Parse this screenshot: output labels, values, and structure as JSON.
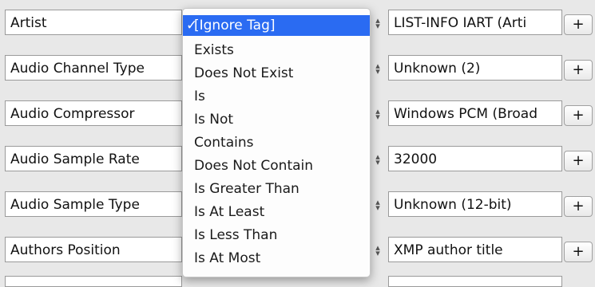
{
  "rows": [
    {
      "tag": "Artist",
      "value": "LIST-INFO IART (Arti",
      "add": "+"
    },
    {
      "tag": "Audio Channel Type",
      "value": "Unknown (2)",
      "add": "+"
    },
    {
      "tag": "Audio Compressor",
      "value": "Windows PCM (Broad",
      "add": "+"
    },
    {
      "tag": "Audio Sample Rate",
      "value": "32000",
      "add": "+"
    },
    {
      "tag": "Audio Sample Type",
      "value": "Unknown (12-bit)",
      "add": "+"
    },
    {
      "tag": "Authors Position",
      "value": "XMP author title",
      "add": "+"
    }
  ],
  "stepper": {
    "up": "▴",
    "down": "▾",
    "icon": "stepper-updown-icon"
  },
  "menu": {
    "check": "✓",
    "selected": "[Ignore Tag]",
    "items": [
      "Exists",
      "Does Not Exist",
      "Is",
      "Is Not",
      "Contains",
      "Does Not Contain",
      "Is Greater Than",
      "Is At Least",
      "Is Less Than",
      "Is At Most"
    ]
  },
  "colors": {
    "selection": "#2a6bf2",
    "background": "#e8e8e8"
  }
}
